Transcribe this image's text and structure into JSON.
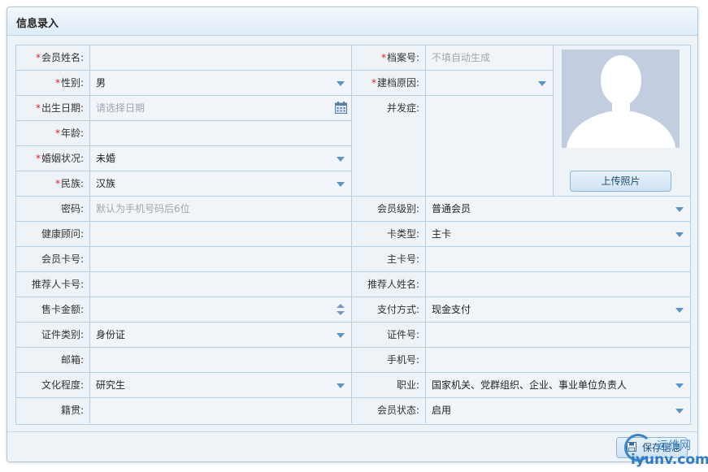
{
  "panel": {
    "title": "信息录入"
  },
  "form": {
    "member_name": {
      "label": "会员姓名:",
      "value": ""
    },
    "file_no": {
      "label": "档案号:",
      "placeholder": "不填自动生成"
    },
    "gender": {
      "label": "性别:",
      "value": "男"
    },
    "file_reason": {
      "label": "建档原因:",
      "value": ""
    },
    "birthday": {
      "label": "出生日期:",
      "placeholder": "请选择日期"
    },
    "complication": {
      "label": "并发症:",
      "value": ""
    },
    "age": {
      "label": "年龄:",
      "value": ""
    },
    "marital": {
      "label": "婚姻状况:",
      "value": "未婚"
    },
    "ethnic": {
      "label": "民族:",
      "value": "汉族"
    },
    "password": {
      "label": "密码:",
      "placeholder": "默认为手机号码后6位"
    },
    "member_level": {
      "label": "会员级别:",
      "value": "普通会员"
    },
    "health_advisor": {
      "label": "健康顾问:",
      "value": ""
    },
    "card_type": {
      "label": "卡类型:",
      "value": "主卡"
    },
    "member_card_no": {
      "label": "会员卡号:",
      "value": ""
    },
    "main_card_no": {
      "label": "主卡号:",
      "value": ""
    },
    "referrer_card_no": {
      "label": "推荐人卡号:",
      "value": ""
    },
    "referrer_name": {
      "label": "推荐人姓名:",
      "value": ""
    },
    "card_amount": {
      "label": "售卡金额:",
      "value": ""
    },
    "pay_method": {
      "label": "支付方式:",
      "value": "现金支付"
    },
    "id_type": {
      "label": "证件类别:",
      "value": "身份证"
    },
    "id_no": {
      "label": "证件号:",
      "value": ""
    },
    "email": {
      "label": "邮箱:",
      "value": ""
    },
    "phone": {
      "label": "手机号:",
      "value": ""
    },
    "education": {
      "label": "文化程度:",
      "value": "研究生"
    },
    "occupation": {
      "label": "职业:",
      "value": "国家机关、党群组织、企业、事业单位负责人"
    },
    "native_place": {
      "label": "籍贯:",
      "value": ""
    },
    "member_status": {
      "label": "会员状态:",
      "value": "启用"
    }
  },
  "photo": {
    "upload_label": "上传照片"
  },
  "footer": {
    "save_label": "保存信息"
  },
  "watermark": {
    "line1": "运维网",
    "line2": "iyunv.com"
  },
  "colors": {
    "required": "#e02020",
    "accent": "#5a93c7",
    "border": "#b5cfe3"
  },
  "icons": {
    "calendar": "calendar-icon",
    "save": "save-icon",
    "avatar": "avatar-placeholder-icon"
  }
}
